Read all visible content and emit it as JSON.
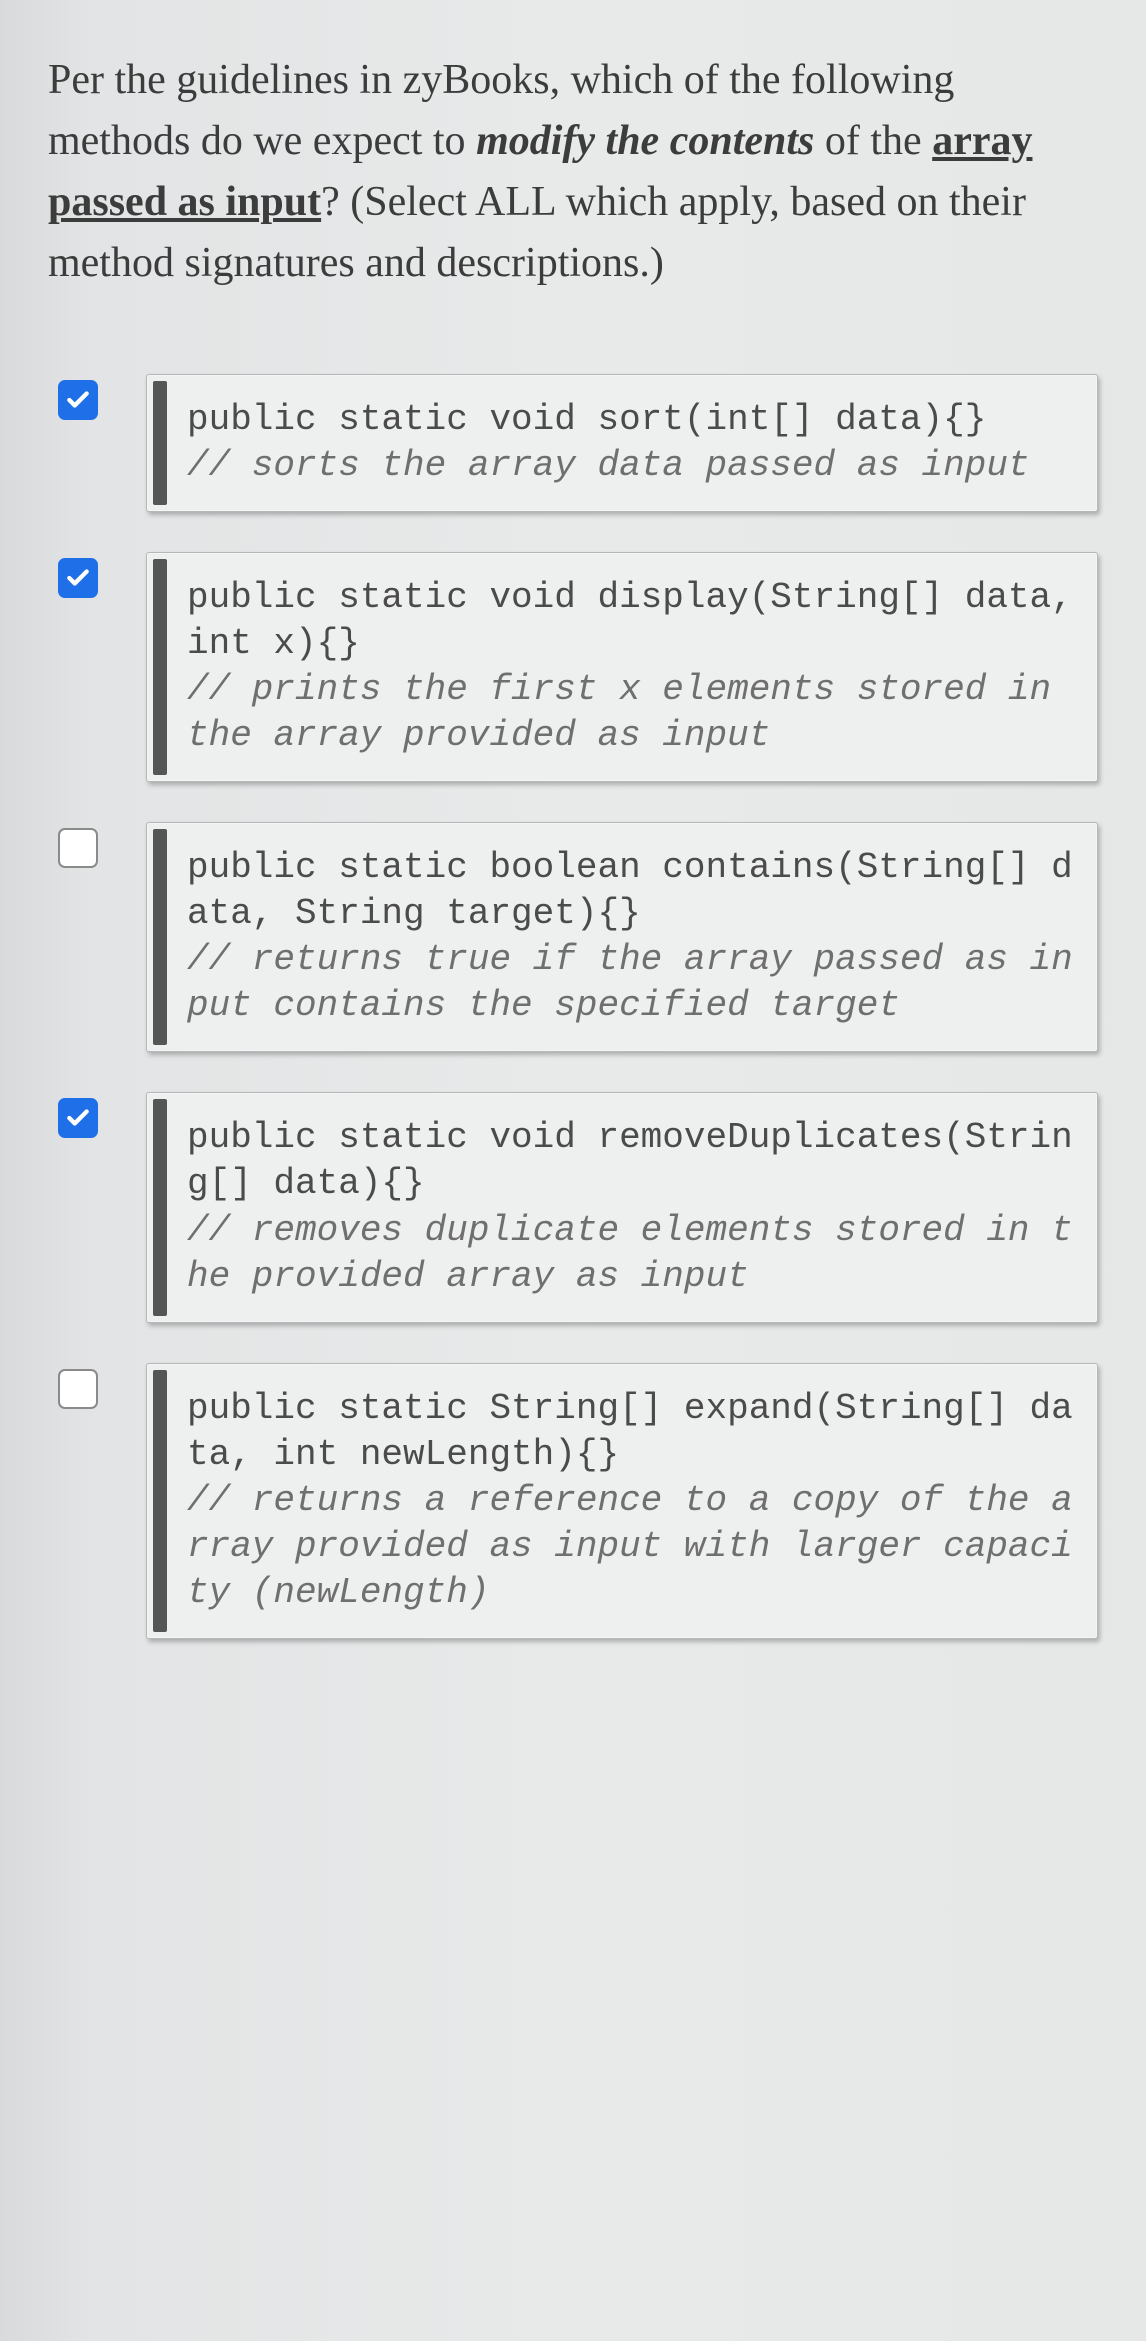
{
  "question": {
    "part1": "Per the guidelines in zyBooks, which of the following methods do we expect to ",
    "emph": "modify the contents",
    "part2": " of the ",
    "underline": "array passed as input",
    "part3": "? (Select ALL which apply, based on their method signatures and descriptions.)"
  },
  "options": [
    {
      "checked": true,
      "signature": "public static void sort(int[] data){}",
      "comment": "// sorts the array data passed as input"
    },
    {
      "checked": true,
      "signature": "public static void display(String[] data, int x){}",
      "comment": "// prints the first x elements stored in the array provided as input"
    },
    {
      "checked": false,
      "signature": "public static boolean contains(String[] data, String target){}",
      "comment": "// returns true if the array passed as input contains the specified target"
    },
    {
      "checked": true,
      "signature": "public static void removeDuplicates(String[] data){}",
      "comment": "// removes duplicate elements stored in the provided array as input"
    },
    {
      "checked": false,
      "signature": "public static String[] expand(String[] data, int newLength){}",
      "comment": "// returns a reference to a copy of the array provided as input with larger capacity (newLength)"
    }
  ]
}
